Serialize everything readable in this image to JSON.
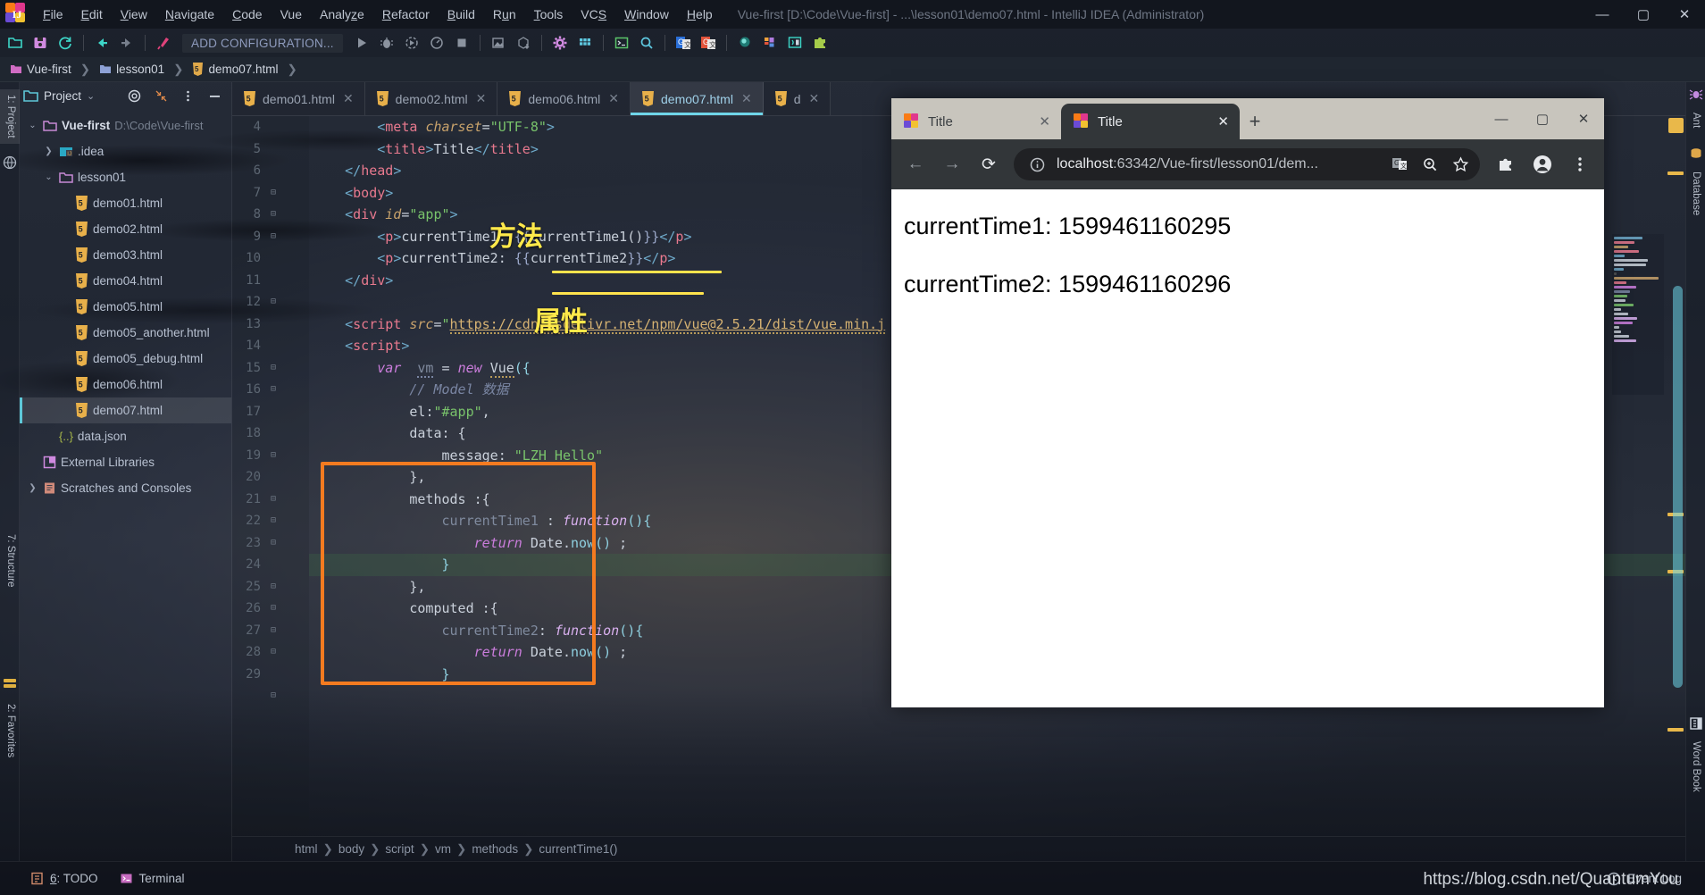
{
  "window": {
    "title": "Vue-first [D:\\Code\\Vue-first] - ...\\lesson01\\demo07.html - IntelliJ IDEA (Administrator)",
    "minimize": "—",
    "maximize": "▢",
    "close": "✕"
  },
  "menu": {
    "items": [
      {
        "label": "File",
        "mnemonic": "F"
      },
      {
        "label": "Edit",
        "mnemonic": "E"
      },
      {
        "label": "View",
        "mnemonic": "V"
      },
      {
        "label": "Navigate",
        "mnemonic": "N"
      },
      {
        "label": "Code",
        "mnemonic": "C"
      },
      {
        "label": "Vue",
        "mnemonic": ""
      },
      {
        "label": "Analyze",
        "mnemonic": "z"
      },
      {
        "label": "Refactor",
        "mnemonic": "R"
      },
      {
        "label": "Build",
        "mnemonic": "B"
      },
      {
        "label": "Run",
        "mnemonic": "u"
      },
      {
        "label": "Tools",
        "mnemonic": "T"
      },
      {
        "label": "VCS",
        "mnemonic": "S"
      },
      {
        "label": "Window",
        "mnemonic": "W"
      },
      {
        "label": "Help",
        "mnemonic": "H"
      }
    ]
  },
  "toolbar": {
    "add_configuration": "ADD CONFIGURATION...",
    "icons": [
      "open-folder-icon",
      "save-all-icon",
      "sync-refresh-icon",
      "navigate-back-icon",
      "navigate-forward-icon",
      "build-hammer-icon",
      "run-icon",
      "debug-icon",
      "run-with-coverage-icon",
      "profile-icon",
      "stop-icon",
      "update-project-icon",
      "commit-icon",
      "settings-gear-icon",
      "project-structure-icon",
      "terminal-icon",
      "search-everywhere-icon",
      "google-translate-icon",
      "google-translate-alt-icon",
      "vue-devtools-icon",
      "layout-icon",
      "plugin-puzzle-icon"
    ]
  },
  "breadcrumb_top": {
    "items": [
      "Vue-first",
      "lesson01",
      "demo07.html"
    ],
    "separator": "❯"
  },
  "left_strip": {
    "tabs": [
      "1: Project",
      "7: Structure",
      "2: Favorites"
    ]
  },
  "right_strip": {
    "tabs": [
      "Ant",
      "Database",
      "Word Book"
    ]
  },
  "project_panel": {
    "title": "Project",
    "chevron": "⌄",
    "header_buttons": [
      "locate-target-icon",
      "collapse-all-icon",
      "options-menu-icon",
      "hide-panel-icon"
    ],
    "tree": [
      {
        "label": "Vue-first",
        "sub": "D:\\Code\\Vue-first",
        "icon": "folder-icon",
        "arrow": "⌄",
        "indent": 0,
        "bold": true,
        "selected": false
      },
      {
        "label": ".idea",
        "sub": "",
        "icon": "idea-folder-icon",
        "arrow": "❯",
        "indent": 1,
        "bold": false,
        "selected": false
      },
      {
        "label": "lesson01",
        "sub": "",
        "icon": "folder-icon",
        "arrow": "⌄",
        "indent": 1,
        "bold": false,
        "selected": false
      },
      {
        "label": "demo01.html",
        "sub": "",
        "icon": "html5-icon",
        "arrow": "",
        "indent": 2,
        "bold": false,
        "selected": false
      },
      {
        "label": "demo02.html",
        "sub": "",
        "icon": "html5-icon",
        "arrow": "",
        "indent": 2,
        "bold": false,
        "selected": false
      },
      {
        "label": "demo03.html",
        "sub": "",
        "icon": "html5-icon",
        "arrow": "",
        "indent": 2,
        "bold": false,
        "selected": false
      },
      {
        "label": "demo04.html",
        "sub": "",
        "icon": "html5-icon",
        "arrow": "",
        "indent": 2,
        "bold": false,
        "selected": false
      },
      {
        "label": "demo05.html",
        "sub": "",
        "icon": "html5-icon",
        "arrow": "",
        "indent": 2,
        "bold": false,
        "selected": false
      },
      {
        "label": "demo05_another.html",
        "sub": "",
        "icon": "html5-icon",
        "arrow": "",
        "indent": 2,
        "bold": false,
        "selected": false
      },
      {
        "label": "demo05_debug.html",
        "sub": "",
        "icon": "html5-icon",
        "arrow": "",
        "indent": 2,
        "bold": false,
        "selected": false
      },
      {
        "label": "demo06.html",
        "sub": "",
        "icon": "html5-icon",
        "arrow": "",
        "indent": 2,
        "bold": false,
        "selected": false
      },
      {
        "label": "demo07.html",
        "sub": "",
        "icon": "html5-icon",
        "arrow": "",
        "indent": 2,
        "bold": false,
        "selected": true
      },
      {
        "label": "data.json",
        "sub": "",
        "icon": "json-icon",
        "arrow": "",
        "indent": 1,
        "bold": false,
        "selected": false
      },
      {
        "label": "External Libraries",
        "sub": "",
        "icon": "libraries-icon",
        "arrow": "",
        "indent": 0,
        "bold": false,
        "selected": false
      },
      {
        "label": "Scratches and Consoles",
        "sub": "",
        "icon": "scratches-icon",
        "arrow": "❯",
        "indent": 0,
        "bold": false,
        "selected": false
      }
    ]
  },
  "editor": {
    "tabs": [
      {
        "label": "demo01.html",
        "active": false
      },
      {
        "label": "demo02.html",
        "active": false
      },
      {
        "label": "demo06.html",
        "active": false
      },
      {
        "label": "demo07.html",
        "active": true
      },
      {
        "label": "d",
        "active": false
      }
    ],
    "close_glyph": "✕",
    "first_line_number": 4,
    "lines": [
      {
        "n": 4,
        "fold": "",
        "highlight": false
      },
      {
        "n": 5,
        "fold": "",
        "highlight": false
      },
      {
        "n": 6,
        "fold": "⊟",
        "highlight": false
      },
      {
        "n": 7,
        "fold": "⊟",
        "highlight": false
      },
      {
        "n": 8,
        "fold": "⊟",
        "highlight": false
      },
      {
        "n": 9,
        "fold": "",
        "highlight": false
      },
      {
        "n": 10,
        "fold": "",
        "highlight": false
      },
      {
        "n": 11,
        "fold": "⊟",
        "highlight": false
      },
      {
        "n": 12,
        "fold": "",
        "highlight": false
      },
      {
        "n": 13,
        "fold": "",
        "highlight": false
      },
      {
        "n": 14,
        "fold": "⊟",
        "highlight": false
      },
      {
        "n": 15,
        "fold": "⊟",
        "highlight": false
      },
      {
        "n": 16,
        "fold": "",
        "highlight": false
      },
      {
        "n": 17,
        "fold": "",
        "highlight": false
      },
      {
        "n": 18,
        "fold": "⊟",
        "highlight": false
      },
      {
        "n": 19,
        "fold": "",
        "highlight": false
      },
      {
        "n": 20,
        "fold": "⊟",
        "highlight": false
      },
      {
        "n": 21,
        "fold": "⊟",
        "highlight": false
      },
      {
        "n": 22,
        "fold": "⊟",
        "highlight": false
      },
      {
        "n": 23,
        "fold": "",
        "highlight": false
      },
      {
        "n": 24,
        "fold": "⊟",
        "highlight": true
      },
      {
        "n": 25,
        "fold": "⊟",
        "highlight": false
      },
      {
        "n": 26,
        "fold": "⊟",
        "highlight": false
      },
      {
        "n": 27,
        "fold": "⊟",
        "highlight": false
      },
      {
        "n": 28,
        "fold": "",
        "highlight": false
      },
      {
        "n": 29,
        "fold": "⊟",
        "highlight": false
      }
    ],
    "code_text": [
      "        <meta charset=\"UTF-8\">",
      "        <title>Title</title>",
      "    </head>",
      "    <body>",
      "    <div id=\"app\">",
      "        <p>currentTime1: {{currentTime1()}}</p>",
      "        <p>currentTime2: {{currentTime2}}</p>",
      "    </div>",
      "",
      "    <script src=\"https://cdn.jsdelivr.net/npm/vue@2.5.21/dist/vue.min.j",
      "    <script>",
      "        var  vm = new Vue({",
      "            // Model 数据",
      "            el:\"#app\",",
      "            data: {",
      "                message: \"LZH_Hello\"",
      "            },",
      "            methods :{",
      "                currentTime1 : function(){",
      "                    return Date.now() ;",
      "                }",
      "            },",
      "            computed :{",
      "                currentTime2: function(){",
      "                    return Date.now() ;",
      "                }"
    ],
    "annotations": [
      {
        "text": "方法",
        "color": "#ffe94a"
      },
      {
        "text": "属性",
        "color": "#ffe94a"
      }
    ],
    "breadcrumb": {
      "items": [
        "html",
        "body",
        "script",
        "vm",
        "methods",
        "currentTime1()"
      ],
      "separator": "❯"
    }
  },
  "status_bar": {
    "todo": "6: TODO",
    "todo_mnemonic": "6",
    "terminal": "Terminal",
    "event_log": "Event Log"
  },
  "watermark": "https://blog.csdn.net/QuantumYou",
  "chrome": {
    "tabs": [
      {
        "title": "Title",
        "active": false
      },
      {
        "title": "Title",
        "active": true
      }
    ],
    "new_tab_glyph": "+",
    "tab_close_glyph": "✕",
    "window_controls": {
      "minimize": "—",
      "maximize": "▢",
      "close": "✕"
    },
    "nav": {
      "back": "←",
      "forward": "→",
      "reload": "⟳"
    },
    "omnibox": {
      "site_info_icon": "info-circle-icon",
      "url_host": "localhost",
      "url_rest": ":63342/Vue-first/lesson01/dem...",
      "trailing_icons": [
        "google-translate-icon",
        "zoom-icon",
        "bookmark-star-icon"
      ]
    },
    "toolbar_icons": [
      "extensions-puzzle-icon",
      "profile-avatar-icon",
      "chrome-menu-icon"
    ],
    "page": {
      "lines": [
        "currentTime1: 1599461160295",
        "currentTime2: 1599461160296"
      ]
    }
  }
}
